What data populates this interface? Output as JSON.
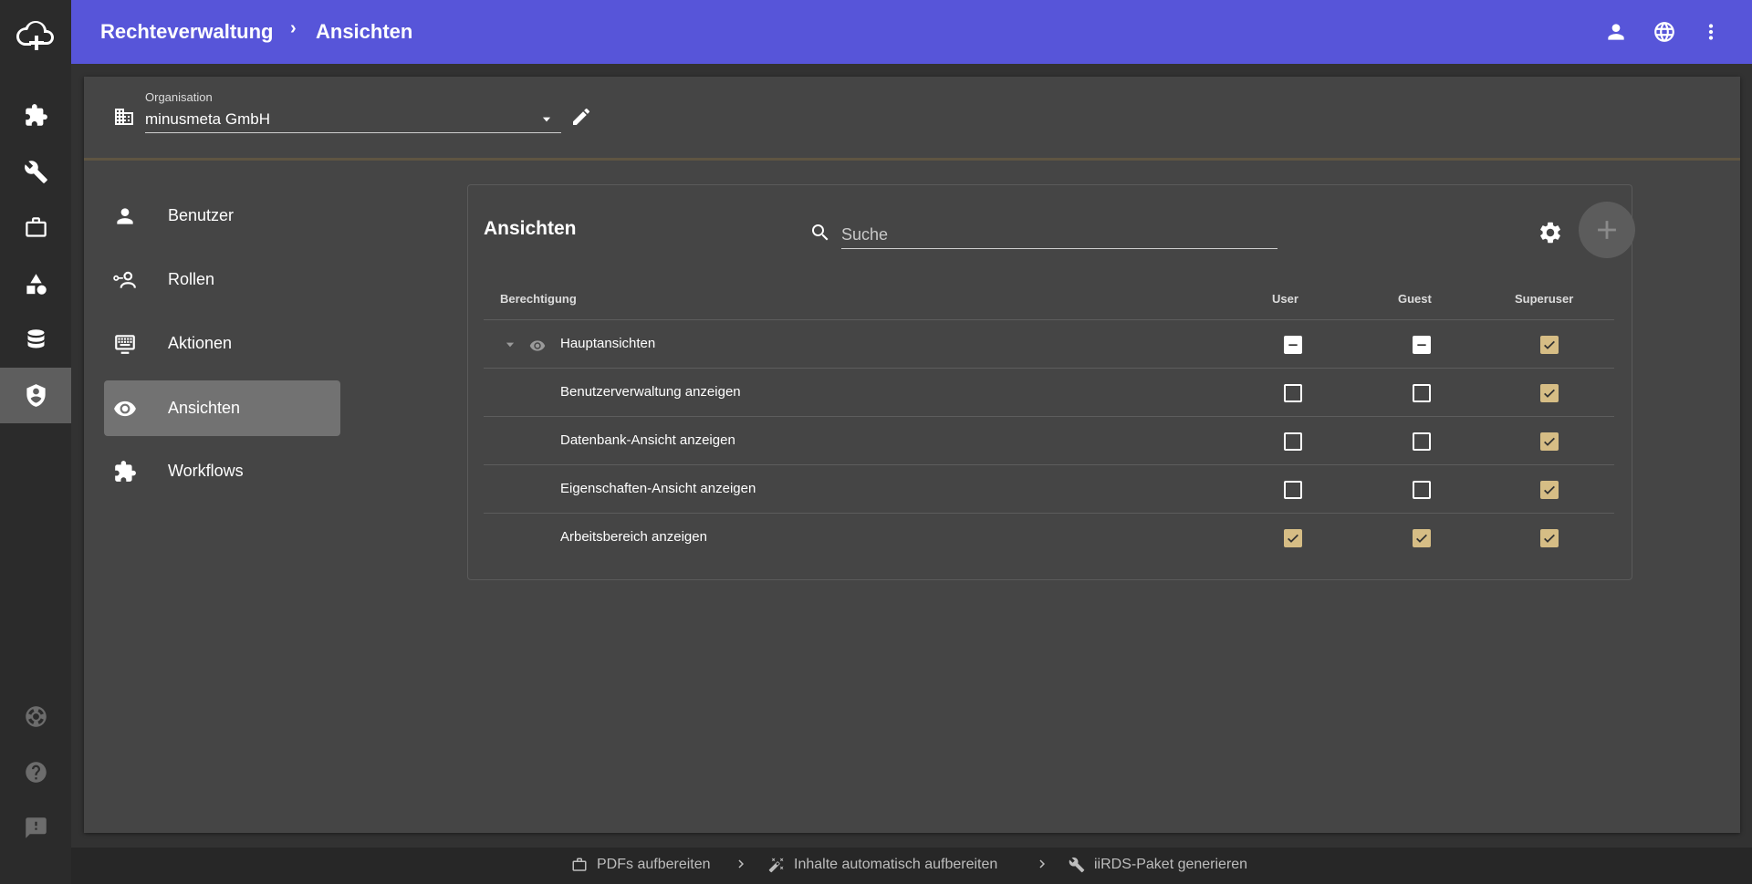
{
  "header": {
    "breadcrumb": [
      "Rechteverwaltung",
      "Ansichten"
    ],
    "separator": "›"
  },
  "organisation": {
    "label": "Organisation",
    "value": "minusmeta GmbH"
  },
  "sidenav": {
    "items": [
      {
        "label": "Benutzer",
        "icon": "person-icon"
      },
      {
        "label": "Rollen",
        "icon": "role-icon"
      },
      {
        "label": "Aktionen",
        "icon": "keyboard-icon"
      },
      {
        "label": "Ansichten",
        "icon": "eye-icon",
        "active": true
      },
      {
        "label": "Workflows",
        "icon": "puzzle-icon"
      }
    ]
  },
  "panel": {
    "title": "Ansichten",
    "search_placeholder": "Suche",
    "columns": [
      "Berechtigung",
      "User",
      "Guest",
      "Superuser"
    ],
    "rows": [
      {
        "label": "Hauptansichten",
        "group": true,
        "user": "indeterminate",
        "guest": "indeterminate",
        "superuser": "checked"
      },
      {
        "label": "Benutzerverwaltung anzeigen",
        "user": "unchecked",
        "guest": "unchecked",
        "superuser": "checked"
      },
      {
        "label": "Datenbank-Ansicht anzeigen",
        "user": "unchecked",
        "guest": "unchecked",
        "superuser": "checked"
      },
      {
        "label": "Eigenschaften-Ansicht anzeigen",
        "user": "unchecked",
        "guest": "unchecked",
        "superuser": "checked"
      },
      {
        "label": "Arbeitsbereich anzeigen",
        "user": "checked",
        "guest": "checked",
        "superuser": "checked"
      }
    ]
  },
  "workflow_bar": {
    "steps": [
      {
        "label": "PDFs aufbereiten",
        "icon": "briefcase-icon"
      },
      {
        "label": "Inhalte automatisch aufbereiten",
        "icon": "magic-wand-icon"
      },
      {
        "label": "iiRDS-Paket generieren",
        "icon": "wrench-icon"
      }
    ]
  },
  "colors": {
    "topbar": "#5755d9",
    "checkbox_checked": "#d6bd85",
    "card": "#454545",
    "background": "#323232"
  }
}
